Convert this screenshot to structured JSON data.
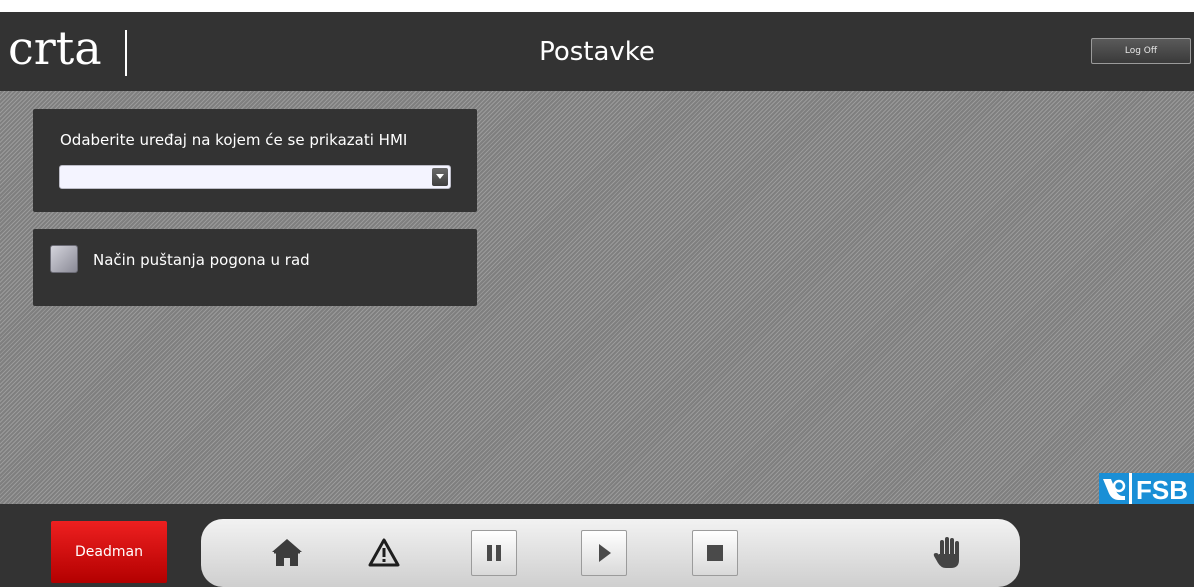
{
  "header": {
    "logo": "crta",
    "title": "Postavke",
    "logoff_label": "Log Off"
  },
  "settings": {
    "device_label": "Odaberite uređaj na kojem će se prikazati HMI",
    "device_value": "",
    "startup_label": "Način puštanja pogona u rad",
    "startup_checked": false
  },
  "branding": {
    "fsb_text": "FSB"
  },
  "footer": {
    "deadman_label": "Deadman",
    "toolbar": {
      "icons": [
        "home-icon",
        "warning-icon",
        "pause-icon",
        "play-icon",
        "stop-icon",
        "hand-icon"
      ]
    }
  },
  "colors": {
    "header_bg": "#333333",
    "deadman": "#d40000",
    "fsb_blue": "#1a8fd6"
  }
}
